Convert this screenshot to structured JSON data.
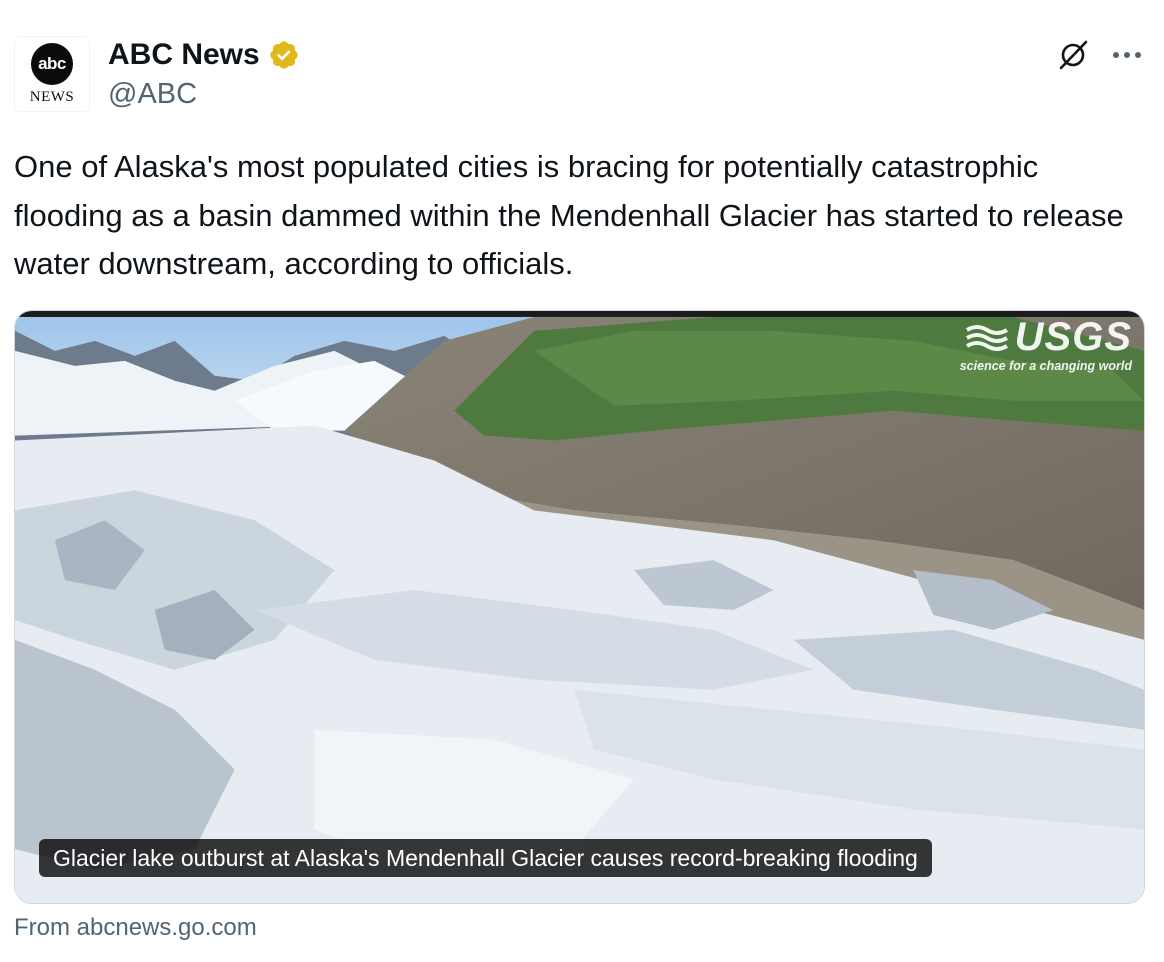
{
  "author": {
    "display_name": "ABC News",
    "handle": "@ABC",
    "avatar_logo_text": "abc",
    "avatar_sub_text": "NEWS",
    "verified_badge_color": "#e2b719"
  },
  "actions": {
    "grok_icon": "grok-icon",
    "more_icon": "more-horizontal-icon"
  },
  "tweet": {
    "text": "One of Alaska's most populated cities is bracing for potentially catastrophic flooding as a basin dammed within the Mendenhall Glacier has started to release water downstream, according to officials."
  },
  "card": {
    "image_description_icon": "glacier-photo",
    "watermark": {
      "title": "USGS",
      "tagline": "science for a changing world"
    },
    "caption": "Glacier lake outburst at Alaska's Mendenhall Glacier causes record-breaking flooding",
    "source": "From abcnews.go.com"
  },
  "colors": {
    "text_primary": "#0f1419",
    "text_secondary": "#536471",
    "border": "#cfd9de"
  }
}
